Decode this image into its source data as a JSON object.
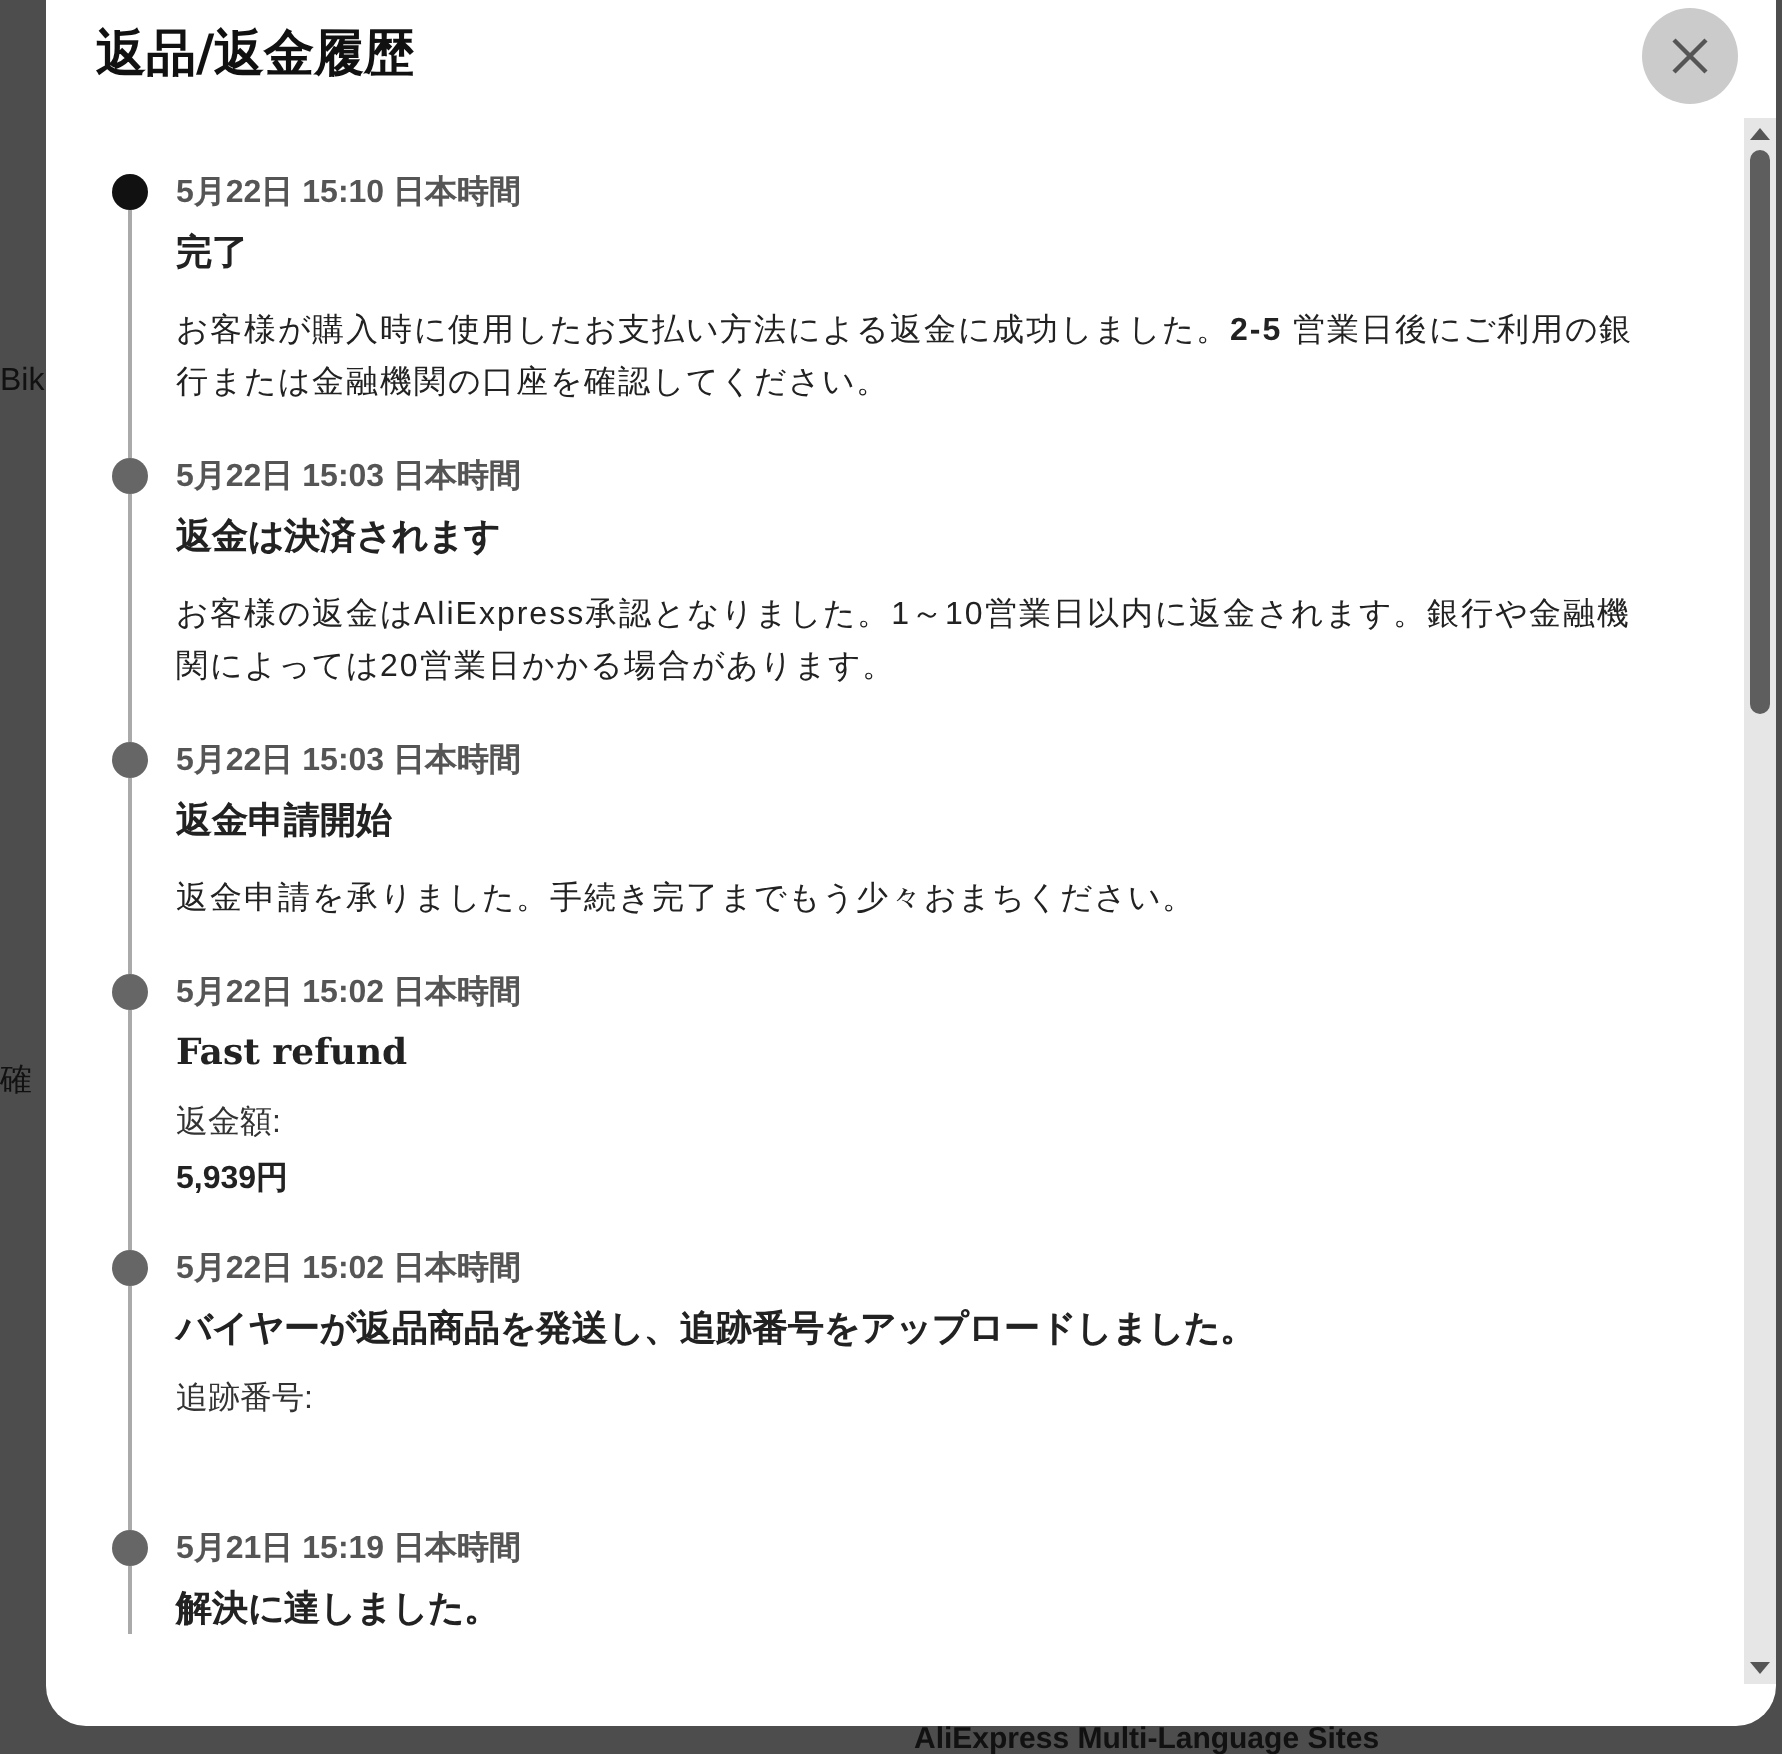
{
  "background": {
    "fragments": [
      "Bik",
      "確"
    ],
    "footer_heading": "AliExpress Multi-Language Sites"
  },
  "dialog": {
    "title": "返品/返金履歴",
    "events": [
      {
        "latest": true,
        "date": "5月22日 15:10 日本時間",
        "title": "完了",
        "kind": "text",
        "body": "お客様が購入時に使用したお支払い方法による返金に成功しました。**2-5** 営業日後にご利用の銀行または金融機関の口座を確認してください。"
      },
      {
        "latest": false,
        "date": "5月22日 15:03 日本時間",
        "title": "返金は決済されます",
        "kind": "text",
        "body": "お客様の返金はAliExpress承認となりました。1～10営業日以内に返金されます。銀行や金融機関によっては20営業日かかる場合があります。"
      },
      {
        "latest": false,
        "date": "5月22日 15:03 日本時間",
        "title": "返金申請開始",
        "kind": "text",
        "body": "返金申請を承りました。手続き完了までもう少々おまちください。"
      },
      {
        "latest": false,
        "date": "5月22日 15:02 日本時間",
        "title": "Fast refund",
        "kind": "amount",
        "label": "返金額:",
        "value": "5,939円"
      },
      {
        "latest": false,
        "date": "5月22日 15:02 日本時間",
        "title": "バイヤーが返品商品を発送し、追跡番号をアップロードしました。",
        "kind": "tracking",
        "label": "追跡番号:"
      },
      {
        "latest": false,
        "date": "5月21日 15:19 日本時間",
        "title": "解決に達しました。",
        "kind": "title_only"
      }
    ]
  }
}
